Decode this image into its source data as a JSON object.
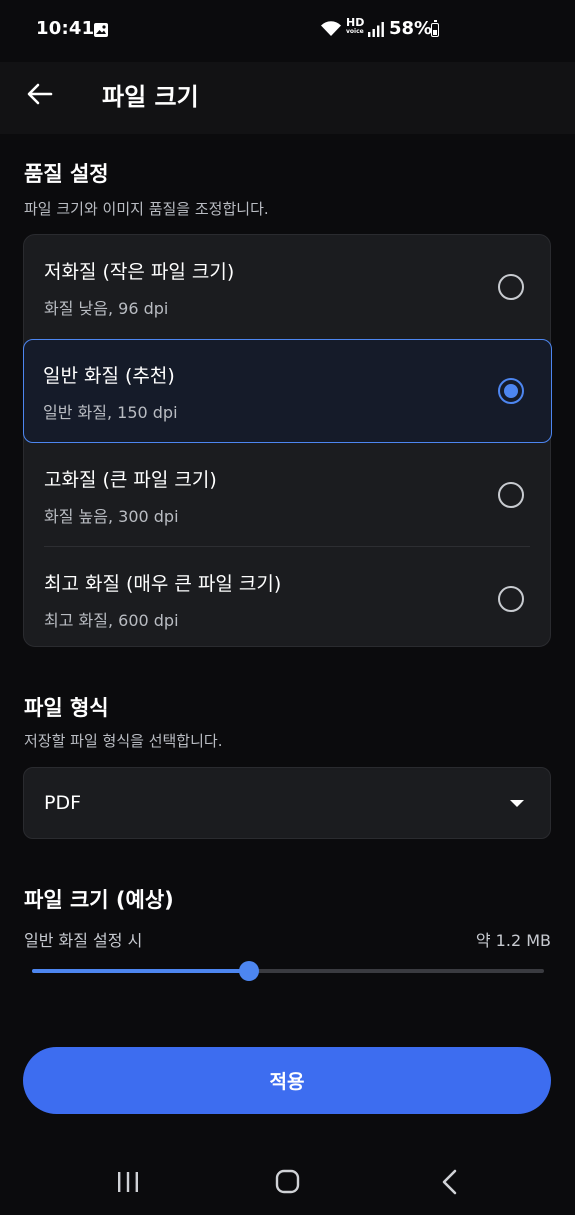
{
  "status_bar": {
    "time": "10:41",
    "hd_label": "HD",
    "hd_sub": "voice",
    "battery": "58%"
  },
  "app_bar": {
    "title": "파일 크기"
  },
  "quality": {
    "title": "품질 설정",
    "description": "파일 크기와 이미지 품질을 조정합니다.",
    "options": [
      {
        "title": "저화질 (작은 파일 크기)",
        "subtitle": "화질 낮음, 96 dpi",
        "selected": false
      },
      {
        "title": "일반 화질 (추천)",
        "subtitle": "일반 화질, 150 dpi",
        "selected": true
      },
      {
        "title": "고화질 (큰 파일 크기)",
        "subtitle": "화질 높음, 300 dpi",
        "selected": false
      },
      {
        "title": "최고 화질 (매우 큰 파일 크기)",
        "subtitle": "최고 화질, 600 dpi",
        "selected": false
      }
    ]
  },
  "format": {
    "title": "파일 형식",
    "description": "저장할 파일 형식을 선택합니다.",
    "selected": "PDF"
  },
  "estimate": {
    "title": "파일 크기 (예상)",
    "label": "일반 화질 설정 시",
    "value": "약 1.2 MB",
    "slider_fraction": 0.424
  },
  "apply_button": "적용",
  "colors": {
    "accent": "#4d86f0",
    "button": "#3d6df0",
    "background": "#0b0b0d",
    "card": "#1b1c1f"
  }
}
